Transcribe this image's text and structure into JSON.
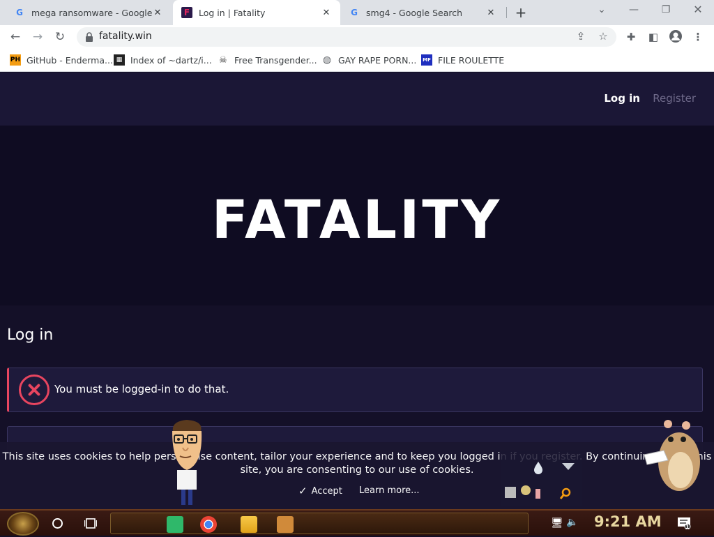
{
  "browser": {
    "tabs": [
      {
        "title": "mega ransomware - Google Sear",
        "active": false
      },
      {
        "title": "Log in | Fatality",
        "active": true
      },
      {
        "title": "smg4 - Google Search",
        "active": false
      }
    ],
    "url": "fatality.win",
    "bookmarks": [
      {
        "label": "GitHub - Enderma...",
        "icon": "PH"
      },
      {
        "label": "Index of ~dartz/i...",
        "icon": "index-icon"
      },
      {
        "label": "Free Transgender...",
        "icon": "skull-icon"
      },
      {
        "label": "GAY RAPE PORN...",
        "icon": "globe-icon"
      },
      {
        "label": "FILE ROULETTE",
        "icon": "MF"
      }
    ]
  },
  "site": {
    "nav": {
      "login": "Log in",
      "register": "Register"
    },
    "logo": "FATALITY",
    "page_title": "Log in",
    "error": "You must be logged-in to do that.",
    "cookie": {
      "text": "This site uses cookies to help personalise content, tailor your experience and to keep you logged in if you register. By continuing to use this site, you are consenting to our use of cookies.",
      "accept": "Accept",
      "learn_more": "Learn more..."
    }
  },
  "taskbar": {
    "clock": "9:21 AM",
    "notification_count": "1"
  },
  "colors": {
    "error": "#e8455f",
    "page_bg": "#141028",
    "hero_bg": "#0f0c22"
  }
}
